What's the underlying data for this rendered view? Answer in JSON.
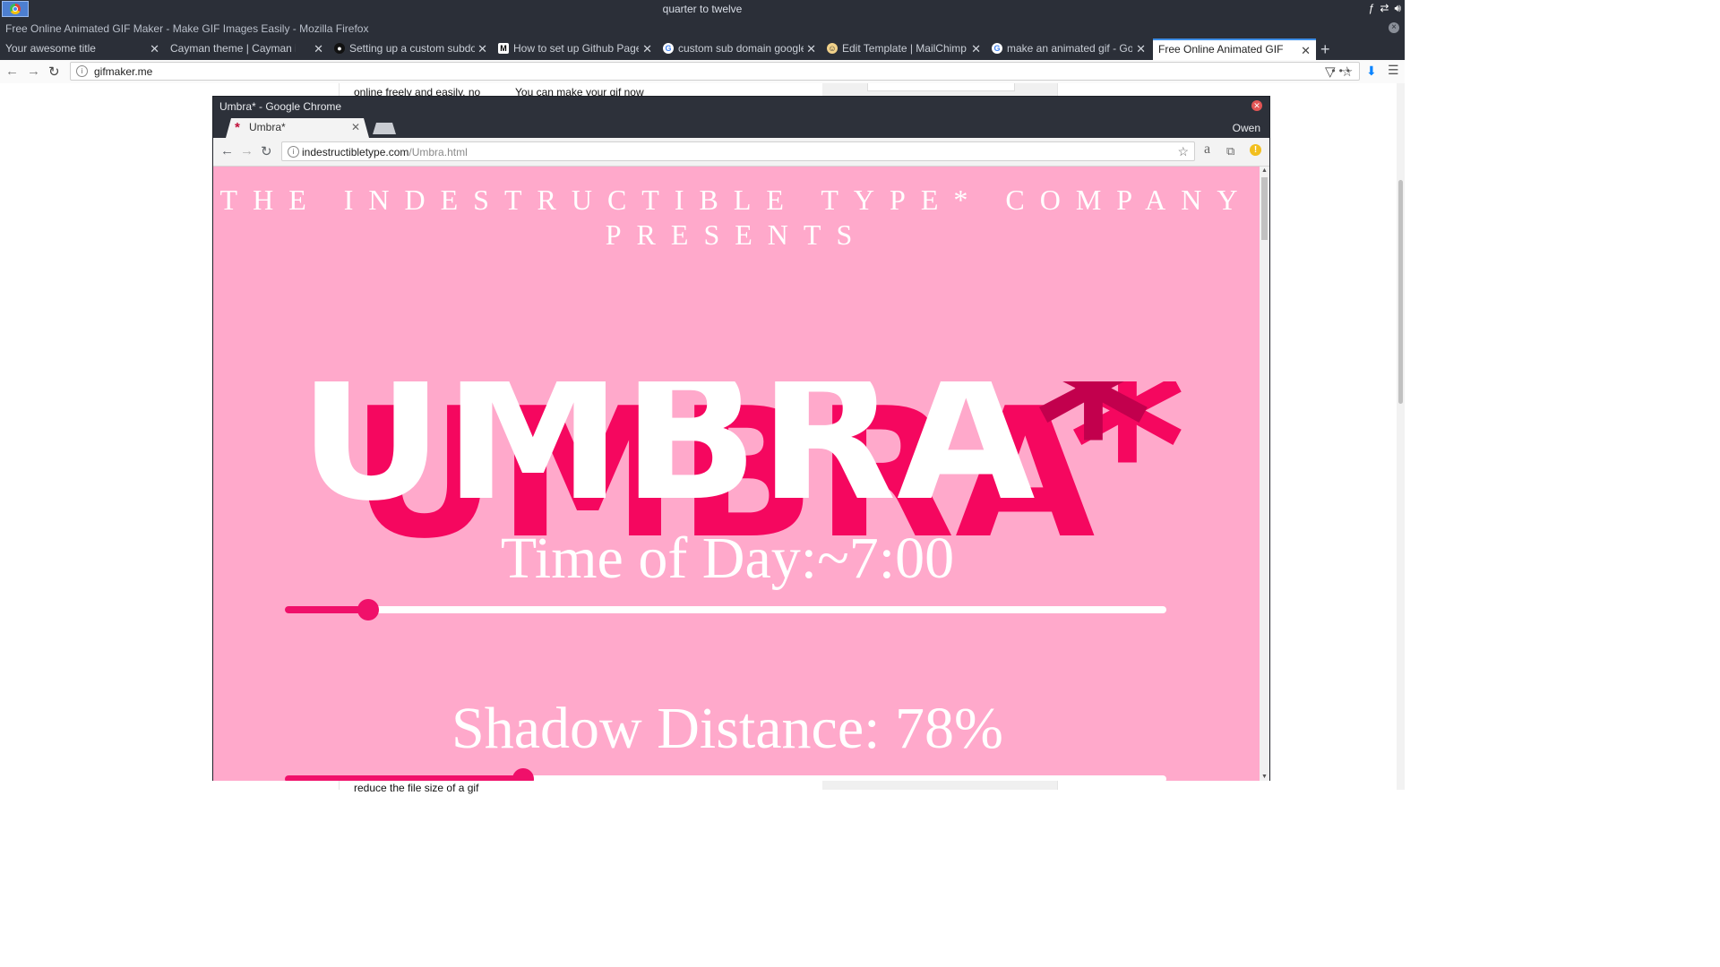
{
  "os": {
    "clock": "quarter to twelve"
  },
  "firefox": {
    "window_title": "Free Online Animated GIF Maker - Make GIF Images Easily - Mozilla Firefox",
    "tabs": [
      {
        "label": "Your awesome title",
        "icon": "none"
      },
      {
        "label": "Cayman theme | Cayman is a cl",
        "icon": "none"
      },
      {
        "label": "Setting up a custom subdom",
        "icon": "github-icon"
      },
      {
        "label": "How to set up Github Pages",
        "icon": "medium-icon"
      },
      {
        "label": "custom sub domain google",
        "icon": "google-icon"
      },
      {
        "label": "Edit Template | MailChimp",
        "icon": "mailchimp-icon"
      },
      {
        "label": "make an animated gif - Goo",
        "icon": "google-icon"
      },
      {
        "label": "Free Online Animated GIF Make",
        "icon": "none",
        "active": true
      }
    ],
    "url": "gifmaker.me",
    "page_fragments": {
      "left_top": "online freely and easily, no",
      "middle_top": "You can make your gif now",
      "left_bottom": "reduce the file size of a gif"
    }
  },
  "chrome": {
    "window_title": "Umbra* - Google Chrome",
    "tab_label": "Umbra*",
    "profile": "Owen",
    "url_host": "indestructibletype.com",
    "url_path": "/Umbra.html"
  },
  "page": {
    "presents_line1": "THE INDESTRUCTIBLE TYPE* COMPANY",
    "presents_line2": "PRESENTS",
    "logo_text": "UMBRA",
    "logo_asterisk": "*",
    "time_label": "Time of Day:~7:00",
    "time_value": 0.095,
    "shadow_label": "Shadow Distance: 78%",
    "shadow_value": 0.27
  },
  "colors": {
    "page_bg": "#ffa9cb",
    "accent": "#f0106a",
    "logo_shadow": "#f5075f",
    "asterisk_front": "#c2004d",
    "text": "#ffffff"
  }
}
